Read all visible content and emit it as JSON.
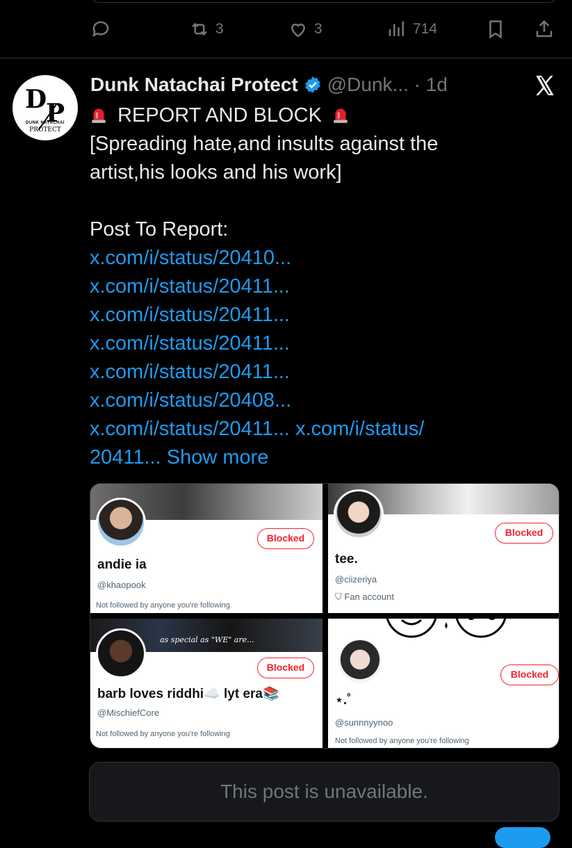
{
  "prev_post": {
    "retweets": "3",
    "likes": "3",
    "views": "714"
  },
  "post": {
    "display_name": "Dunk Natachai Protect",
    "handle_time": "@Dunk... · 1d",
    "heading": "REPORT AND BLOCK",
    "reason": "[Spreading hate,and insults against the artist,his looks and his work]",
    "report_label": "Post To Report:",
    "links": [
      "x.com/i/status/20410...",
      "x.com/i/status/20411...",
      "x.com/i/status/20411...",
      "x.com/i/status/20411...",
      "x.com/i/status/20411...",
      "x.com/i/status/20408..."
    ],
    "last_line_link_a": "x.com/i/status/20411...",
    "last_line_link_b": "x.com/i/status/",
    "last_line_link_c": "20411...",
    "show_more": "Show more"
  },
  "avatar_logo": {
    "d": "D",
    "p": "P",
    "line1": "DUNK NATACHAI",
    "line2": "PROTECT"
  },
  "media_tiles": [
    {
      "name": "andie ia",
      "handle": "@khaopook",
      "note": "Not followed by anyone you're following",
      "button": "Blocked"
    },
    {
      "name": "tee.",
      "handle": "@ciizeriya",
      "note": "Fan account",
      "button": "Blocked"
    },
    {
      "name": "barb loves riddhi☁️ lyt era📚",
      "handle": "@MischiefCore",
      "note": "Not followed by anyone you're following",
      "button": "Blocked",
      "banner_text": "as special as \"WE\" are..."
    },
    {
      "name": "⋆.˚",
      "handle": "@sunnnyynoo",
      "note": "Not followed by anyone you're following",
      "button": "Blocked"
    }
  ],
  "unavailable_text": "This post is unavailable.",
  "colors": {
    "background": "#000000",
    "text": "#e7e9ea",
    "muted": "#71767b",
    "link": "#1d9bf0",
    "blocked": "#f4212e",
    "border": "#2f3336"
  }
}
